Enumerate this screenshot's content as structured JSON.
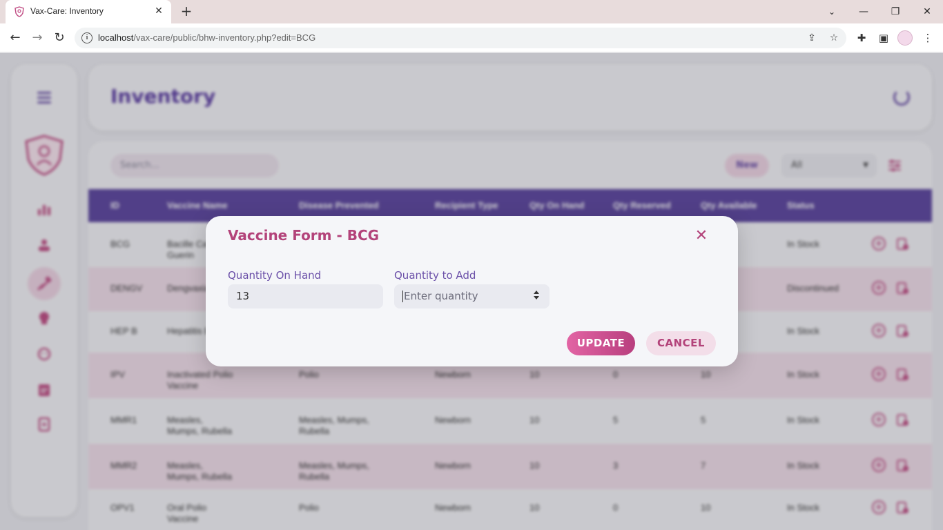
{
  "browser": {
    "tab_title": "Vax-Care: Inventory",
    "url_host": "localhost",
    "url_path": "/vax-care/public/bhw-inventory.php?edit=BCG"
  },
  "header": {
    "title": "Inventory"
  },
  "toolbar": {
    "search_placeholder": "Search...",
    "new_label": "New",
    "filter_value": "All"
  },
  "table": {
    "columns": [
      "ID",
      "Vaccine Name",
      "Disease Prevented",
      "Recipient Type",
      "Qty On Hand",
      "Qty Reserved",
      "Qty Available",
      "Status"
    ],
    "rows": [
      {
        "id": "BCG",
        "name": "Bacille Calmette-Guerin",
        "disease": "",
        "recipient": "",
        "on_hand": "",
        "reserved": "",
        "available": "",
        "status": "In Stock"
      },
      {
        "id": "DENGV",
        "name": "Dengvaxia",
        "disease": "",
        "recipient": "",
        "on_hand": "",
        "reserved": "",
        "available": "",
        "status": "Discontinued"
      },
      {
        "id": "HEP B",
        "name": "Hepatitis B",
        "disease": "",
        "recipient": "",
        "on_hand": "",
        "reserved": "",
        "available": "",
        "status": "In Stock"
      },
      {
        "id": "IPV",
        "name": "Inactivated Polio Vaccine",
        "disease": "Polio",
        "recipient": "Newborn",
        "on_hand": "10",
        "reserved": "0",
        "available": "10",
        "status": "In Stock"
      },
      {
        "id": "MMR1",
        "name": "Measles, Mumps, Rubella",
        "disease": "Measles, Mumps, Rubella",
        "recipient": "Newborn",
        "on_hand": "10",
        "reserved": "5",
        "available": "5",
        "status": "In Stock"
      },
      {
        "id": "MMR2",
        "name": "Measles, Mumps, Rubella",
        "disease": "Measles, Mumps, Rubella",
        "recipient": "Newborn",
        "on_hand": "10",
        "reserved": "3",
        "available": "7",
        "status": "In Stock"
      },
      {
        "id": "OPV1",
        "name": "Oral Polio Vaccine",
        "disease": "Polio",
        "recipient": "Newborn",
        "on_hand": "10",
        "reserved": "0",
        "available": "10",
        "status": "In Stock"
      }
    ]
  },
  "modal": {
    "title": "Vaccine Form - BCG",
    "on_hand_label": "Quantity On Hand",
    "on_hand_value": "13",
    "add_label": "Quantity to Add",
    "add_placeholder": "Enter quantity",
    "update_label": "UPDATE",
    "cancel_label": "CANCEL"
  },
  "colors": {
    "brand_purple": "#5d46a0",
    "brand_pink": "#b3437a"
  }
}
